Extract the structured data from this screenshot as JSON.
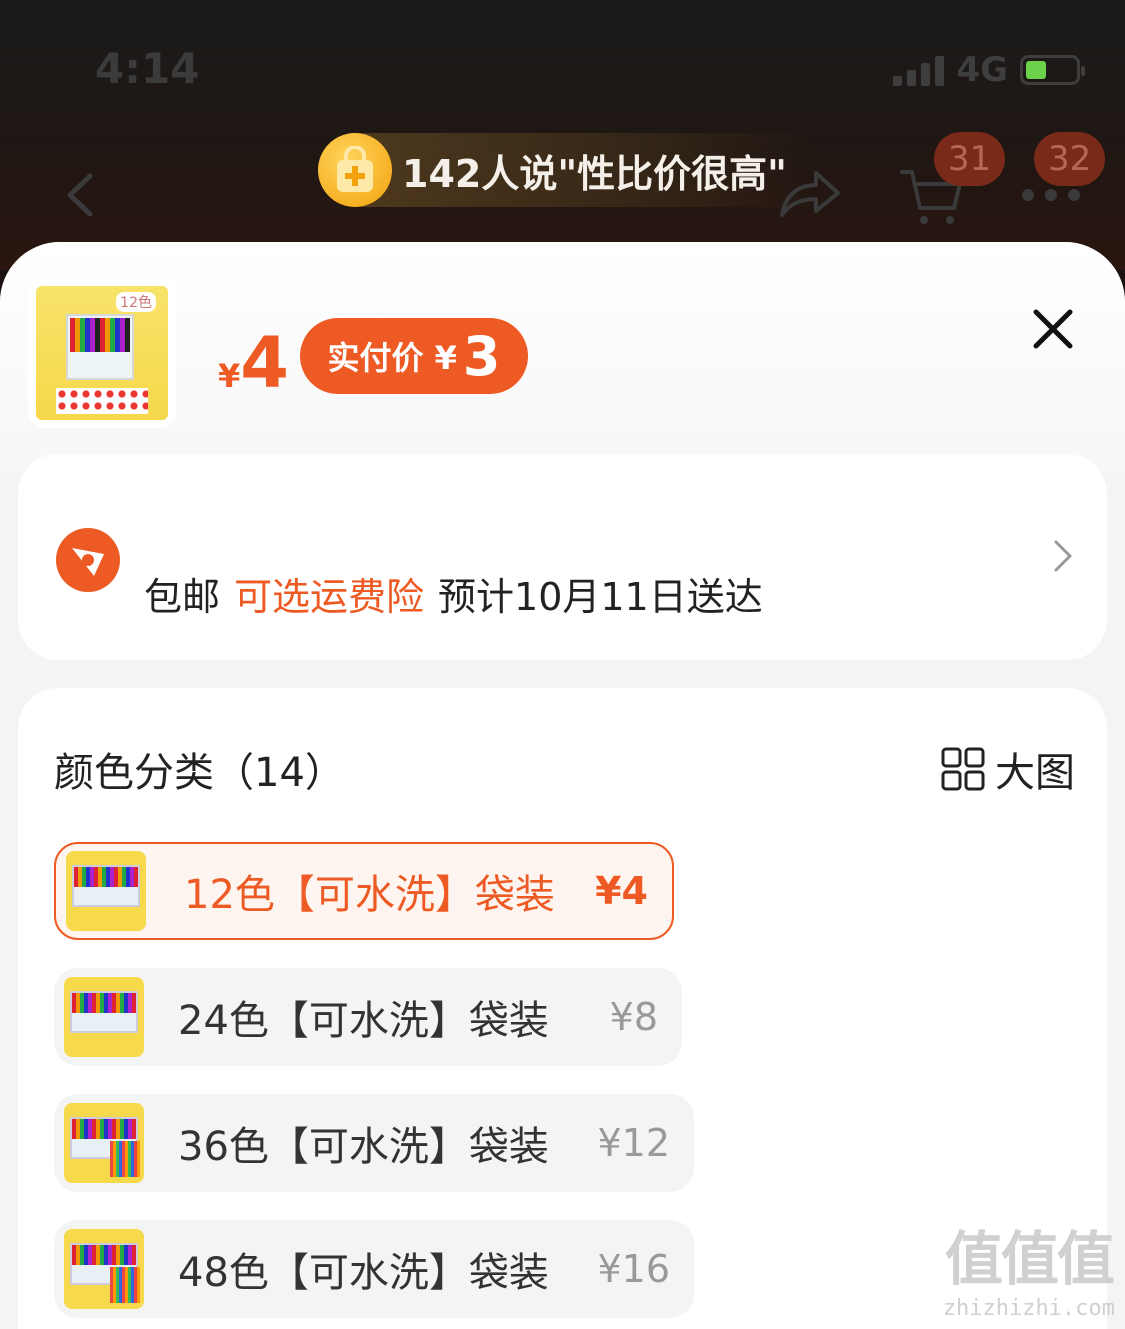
{
  "status_bar": {
    "time": "4:14",
    "network": "4G"
  },
  "header": {
    "promo_text": "142人说\"性比价很高\"",
    "cart_badge": "31",
    "more_badge": "32"
  },
  "product": {
    "thumb_tag": "12色",
    "currency": "¥",
    "price": "4",
    "pay_label": "实付价 ¥",
    "pay_price": "3"
  },
  "shipping": {
    "free": "包邮",
    "insurance": "可选运费险",
    "eta": "预计10月11日送达"
  },
  "color_section": {
    "title": "颜色分类（14）",
    "big_image_label": "大图",
    "options": [
      {
        "label": "12色【可水洗】袋装",
        "price": "¥4",
        "selected": true
      },
      {
        "label": "24色【可水洗】袋装",
        "price": "¥8",
        "selected": false
      },
      {
        "label": "36色【可水洗】袋装",
        "price": "¥12",
        "selected": false
      },
      {
        "label": "48色【可水洗】袋装",
        "price": "¥16",
        "selected": false
      }
    ]
  },
  "watermark": {
    "big": "值值值",
    "small": "zhizhizhi.com"
  },
  "colors": {
    "accent": "#ee5a24",
    "sheet_bg": "#f4f4f4",
    "selected_bg": "#fff5f0"
  }
}
